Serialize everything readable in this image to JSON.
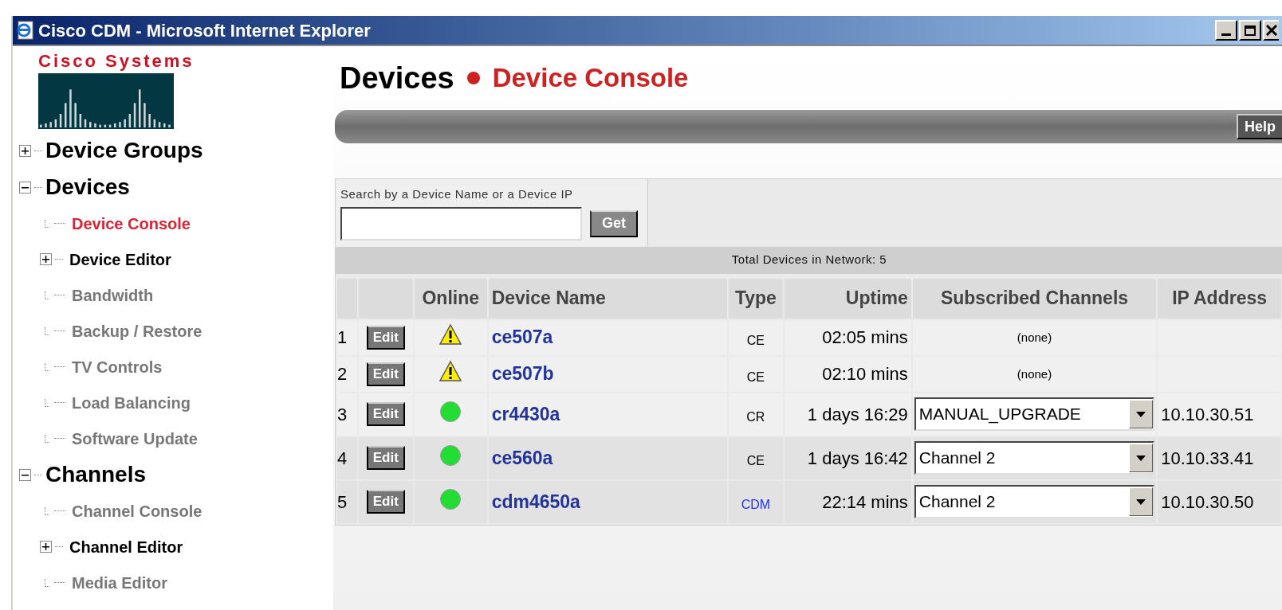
{
  "window": {
    "title": "Cisco CDM - Microsoft Internet Explorer"
  },
  "sidebar": {
    "logo_text": "Cisco Systems",
    "tree": [
      {
        "label": "Device Groups",
        "expanded": false
      },
      {
        "label": "Devices",
        "expanded": true,
        "children": [
          {
            "label": "Device Console",
            "kind": "page",
            "selected": true
          },
          {
            "label": "Device Editor",
            "kind": "folder",
            "expanded": false,
            "selected": false
          },
          {
            "label": "Bandwidth",
            "kind": "page",
            "selected": false
          },
          {
            "label": "Backup / Restore",
            "kind": "page",
            "selected": false
          },
          {
            "label": "TV Controls",
            "kind": "page",
            "selected": false
          },
          {
            "label": "Load Balancing",
            "kind": "page",
            "selected": false
          },
          {
            "label": "Software Update",
            "kind": "page",
            "selected": false
          }
        ]
      },
      {
        "label": "Channels",
        "expanded": true,
        "children": [
          {
            "label": "Channel Console",
            "kind": "page",
            "selected": false
          },
          {
            "label": "Channel Editor",
            "kind": "folder",
            "expanded": false,
            "selected": false
          },
          {
            "label": "Media Editor",
            "kind": "page",
            "selected": false
          }
        ]
      }
    ]
  },
  "header": {
    "section": "Devices",
    "page": "Device Console"
  },
  "help_button": "Help",
  "search": {
    "label": "Search by a Device Name or a Device IP",
    "button": "Get"
  },
  "total": "Total Devices in Network: 5",
  "table": {
    "columns": [
      "Online",
      "Device Name",
      "Type",
      "Uptime",
      "Subscribed Channels",
      "IP Address"
    ],
    "rows": [
      {
        "index": "1",
        "edit": "Edit",
        "online": {
          "kind": "warning"
        },
        "name": "ce507a",
        "type": "CE",
        "type_link": false,
        "uptime": "02:05 mins",
        "channels": {
          "kind": "text",
          "value": "(none)"
        }
      },
      {
        "index": "2",
        "edit": "Edit",
        "online": {
          "kind": "warning"
        },
        "name": "ce507b",
        "type": "CE",
        "type_link": false,
        "uptime": "02:10 mins",
        "channels": {
          "kind": "text",
          "value": "(none)"
        }
      },
      {
        "index": "3",
        "edit": "Edit",
        "online": {
          "kind": "online"
        },
        "name": "cr4430a",
        "type": "CR",
        "type_link": false,
        "uptime": "1 days 16:29",
        "channels": {
          "kind": "select",
          "value": "MANUAL_UPGRADE"
        },
        "ip": "10.10.30.51"
      },
      {
        "index": "4",
        "edit": "Edit",
        "online": {
          "kind": "online"
        },
        "name": "ce560a",
        "type": "CE",
        "type_link": false,
        "uptime": "1 days 16:42",
        "channels": {
          "kind": "select",
          "value": "Channel 2"
        },
        "ip": "10.10.33.41"
      },
      {
        "index": "5",
        "edit": "Edit",
        "online": {
          "kind": "online"
        },
        "name": "cdm4650a",
        "type": "CDM",
        "type_link": true,
        "uptime": "22:14 mins",
        "channels": {
          "kind": "select",
          "value": "Channel 2"
        },
        "ip": "10.10.30.50"
      }
    ]
  }
}
